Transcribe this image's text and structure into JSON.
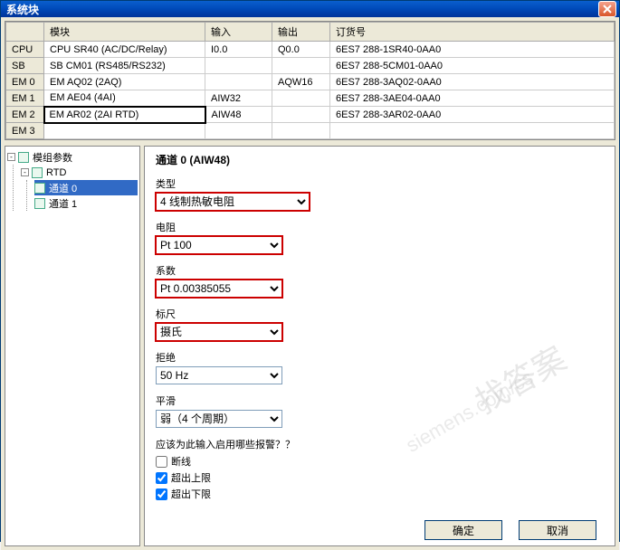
{
  "window": {
    "title": "系统块"
  },
  "table": {
    "headers": {
      "c0": "",
      "c1": "模块",
      "c2": "输入",
      "c3": "输出",
      "c4": "订货号"
    },
    "rows": [
      {
        "slot": "CPU",
        "module": "CPU SR40 (AC/DC/Relay)",
        "in": "I0.0",
        "out": "Q0.0",
        "order": "6ES7 288-1SR40-0AA0",
        "sel": false
      },
      {
        "slot": "SB",
        "module": "SB CM01 (RS485/RS232)",
        "in": "",
        "out": "",
        "order": "6ES7 288-5CM01-0AA0",
        "sel": false
      },
      {
        "slot": "EM 0",
        "module": "EM AQ02 (2AQ)",
        "in": "",
        "out": "AQW16",
        "order": "6ES7 288-3AQ02-0AA0",
        "sel": false
      },
      {
        "slot": "EM 1",
        "module": "EM AE04 (4AI)",
        "in": "AIW32",
        "out": "",
        "order": "6ES7 288-3AE04-0AA0",
        "sel": false
      },
      {
        "slot": "EM 2",
        "module": "EM AR02 (2AI RTD)",
        "in": "AIW48",
        "out": "",
        "order": "6ES7 288-3AR02-0AA0",
        "sel": true
      },
      {
        "slot": "EM 3",
        "module": "",
        "in": "",
        "out": "",
        "order": "",
        "sel": false
      }
    ]
  },
  "tree": {
    "root": "模组参数",
    "node": "RTD",
    "ch0": "通道 0",
    "ch1": "通道 1"
  },
  "detail": {
    "title": "通道 0 (AIW48)",
    "type_label": "类型",
    "type_value": "4 线制热敏电阻",
    "res_label": "电阻",
    "res_value": "Pt 100",
    "coef_label": "系数",
    "coef_value": "Pt 0.00385055",
    "scale_label": "标尺",
    "scale_value": "摄氏",
    "rej_label": "拒绝",
    "rej_value": "50 Hz",
    "smooth_label": "平滑",
    "smooth_value": "弱（4 个周期）",
    "alarm_q": "应该为此输入启用哪些报警？？",
    "chk_break": "断线",
    "chk_over": "超出上限",
    "chk_under": "超出下限"
  },
  "buttons": {
    "ok": "确定",
    "cancel": "取消"
  },
  "watermark": {
    "big": "找答案",
    "small": "siemens.com/cs"
  }
}
